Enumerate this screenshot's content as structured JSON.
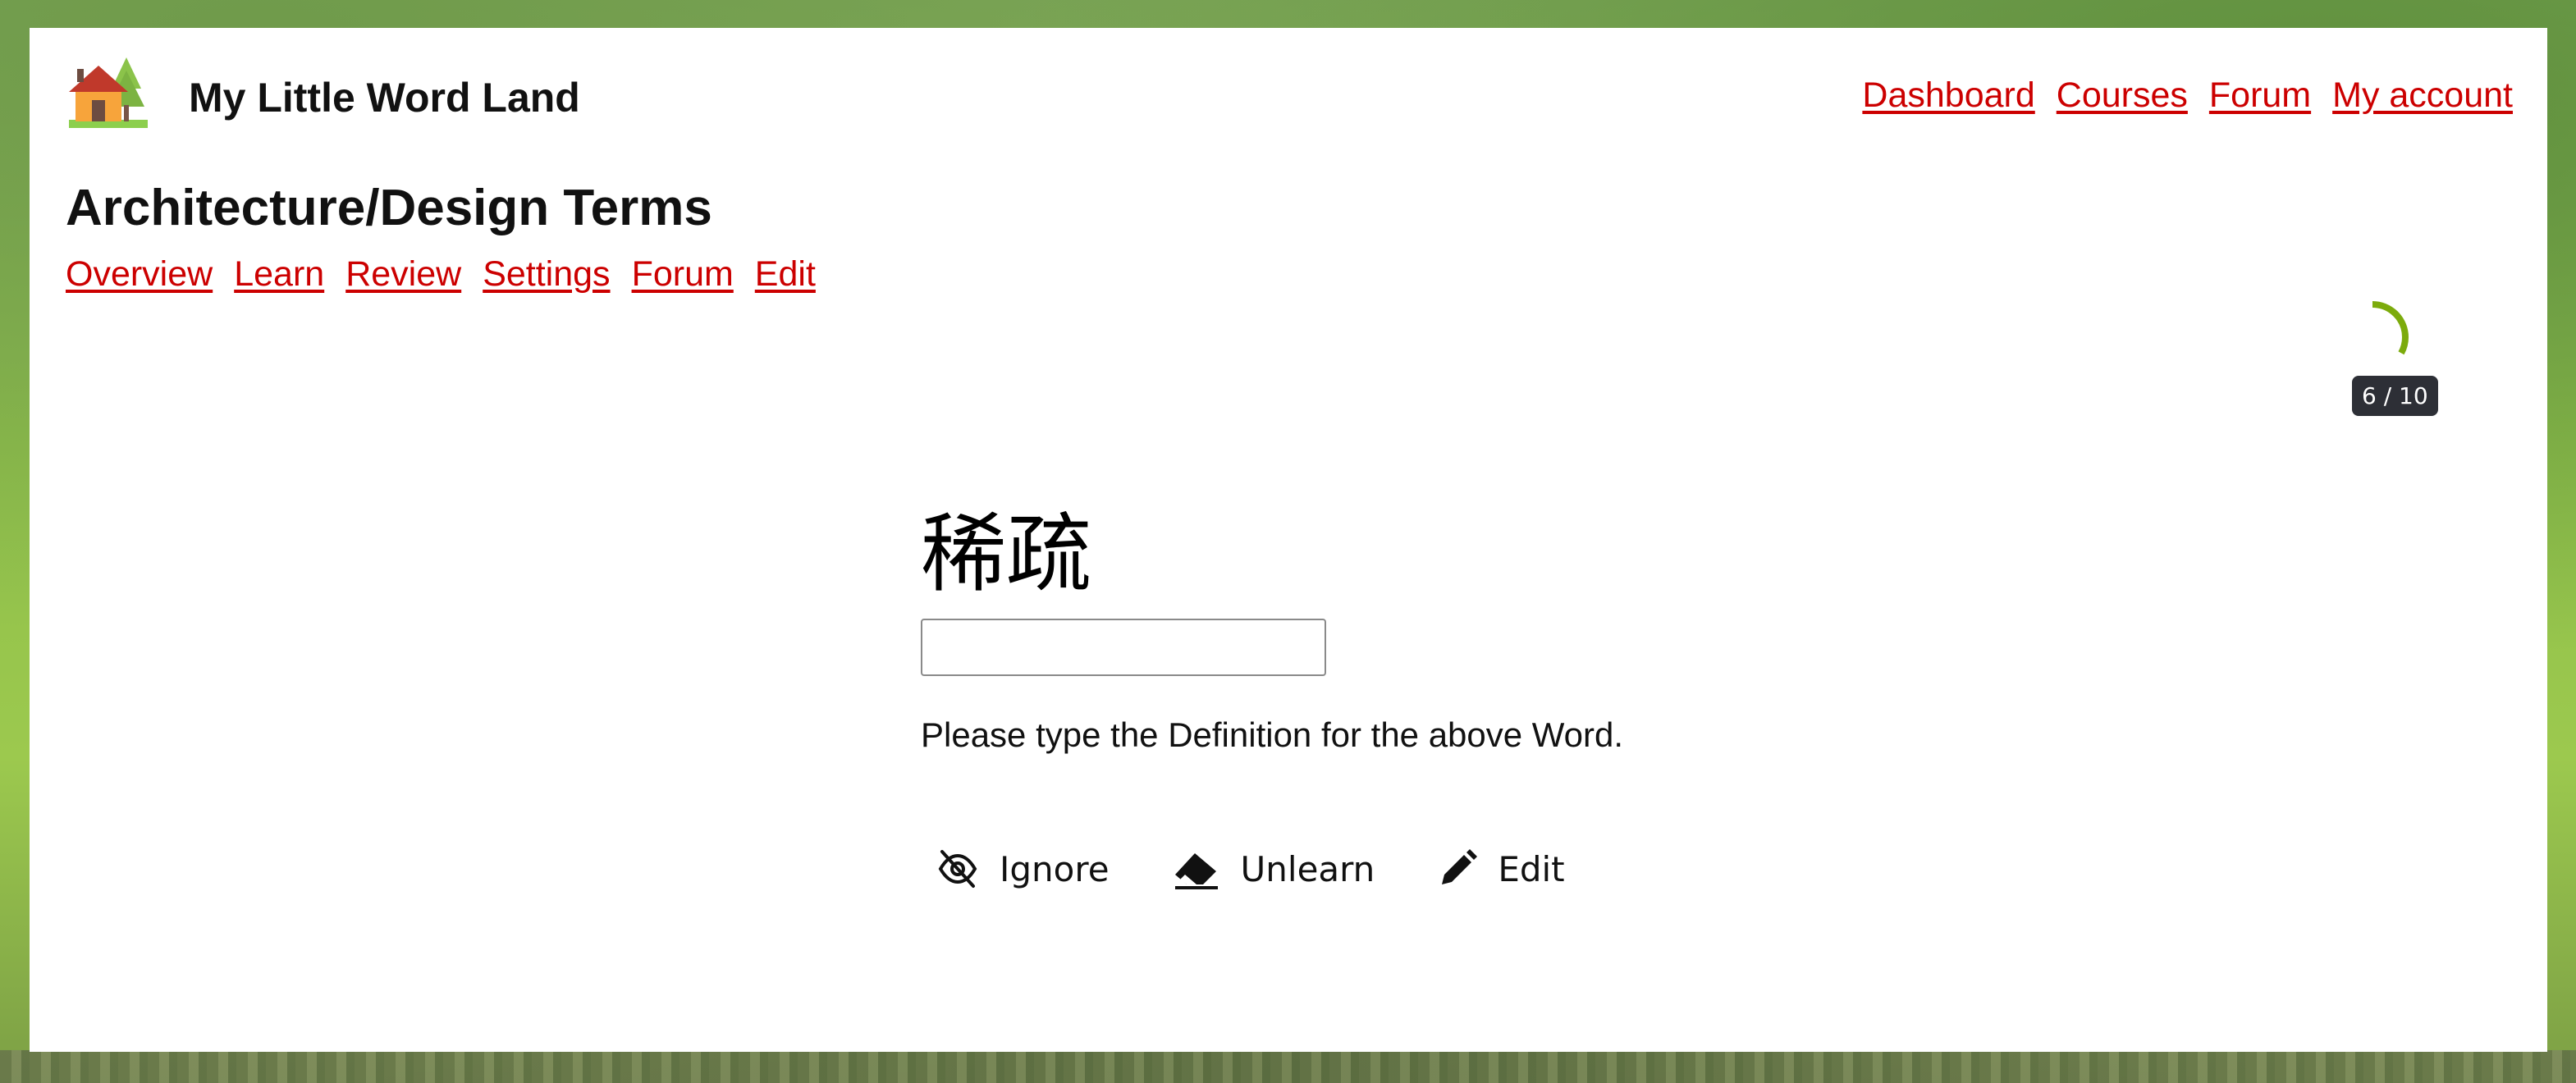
{
  "header": {
    "app_title": "My Little Word Land",
    "logo_icon": "house-icon",
    "nav": [
      {
        "label": "Dashboard"
      },
      {
        "label": "Courses"
      },
      {
        "label": "Forum"
      },
      {
        "label": "My account"
      }
    ]
  },
  "course": {
    "title": "Architecture/Design Terms",
    "tabs": [
      {
        "label": "Overview"
      },
      {
        "label": "Learn"
      },
      {
        "label": "Review"
      },
      {
        "label": "Settings"
      },
      {
        "label": "Forum"
      },
      {
        "label": "Edit"
      }
    ]
  },
  "progress": {
    "current": 6,
    "total": 10,
    "label": "6 / 10",
    "color": "#7cab0c"
  },
  "quiz": {
    "word": "稀疏",
    "answer_value": "",
    "answer_placeholder": "",
    "instruction": "Please type the Definition for the above Word."
  },
  "actions": [
    {
      "label": "Ignore",
      "icon": "eye-slash-icon"
    },
    {
      "label": "Unlearn",
      "icon": "eraser-icon"
    },
    {
      "label": "Edit",
      "icon": "pencil-icon"
    }
  ],
  "colors": {
    "link": "#cc0000",
    "badge_bg": "#2d2f36"
  }
}
